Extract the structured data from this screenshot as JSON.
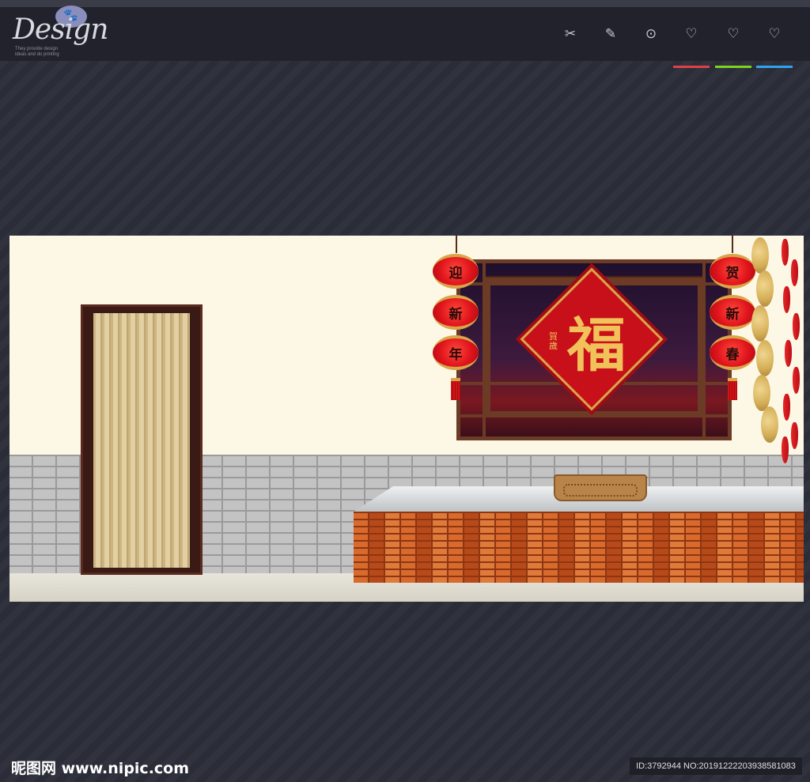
{
  "header": {
    "logo_script": "Design",
    "logo_paw": "🐾",
    "logo_tagline": "They provide design ideas and do printing",
    "nav": [
      {
        "icon": "scissors-icon",
        "glyph": "✂",
        "underline": ""
      },
      {
        "icon": "pencil-icon",
        "glyph": "✎",
        "underline": ""
      },
      {
        "icon": "clock-check-icon",
        "glyph": "⊙",
        "underline": ""
      },
      {
        "icon": "heart-icon",
        "glyph": "♡",
        "underline": "#e0404a"
      },
      {
        "icon": "heart-plus-icon",
        "glyph": "♡",
        "underline": "#7ed321"
      },
      {
        "icon": "heart-minus-icon",
        "glyph": "♡",
        "underline": "#2fa4f0"
      }
    ]
  },
  "scene": {
    "lantern_left": [
      "迎",
      "新",
      "年"
    ],
    "lantern_right": [
      "贺",
      "新",
      "春"
    ],
    "fu_char": "福",
    "fu_side": "賀歲"
  },
  "watermark": {
    "logo": "昵图网 www.nipic.com",
    "id_text": "ID:3792944 NO:20191222203938581083"
  },
  "colors": {
    "page_bg": "#2e303c",
    "header_bg": "#21222b",
    "accent_red": "#e0404a",
    "accent_green": "#7ed321",
    "accent_blue": "#2fa4f0",
    "lantern_red": "#e0141c",
    "gold": "#d9a54a"
  }
}
